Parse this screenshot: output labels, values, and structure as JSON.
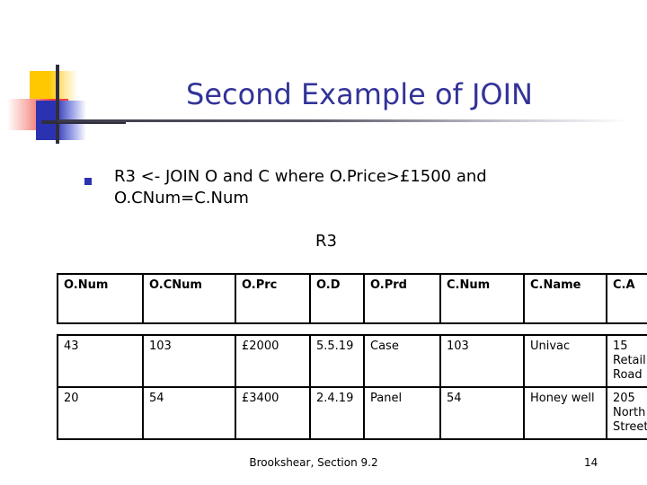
{
  "slide": {
    "title": "Second Example of JOIN",
    "title_color": "#333399",
    "logo": {
      "yellow": "#FFC800",
      "red": "#F2413C",
      "blue": "#2B32B2",
      "line": "#2F2F3F"
    },
    "bullet": {
      "marker": "square-bullet",
      "marker_color": "#2B32B2",
      "text": "R3 <- JOIN O and C where O.Price>£1500 and O.CNum=C.Num"
    },
    "relation_label": "R3",
    "table": {
      "headers": [
        "O.Num",
        "O.CNum",
        "O.Prc",
        "O.D",
        "O.Prd",
        "C.Num",
        "C.Name",
        "C.A"
      ],
      "rows": [
        [
          "43",
          "103",
          "£2000",
          "5.5.19",
          "Case",
          "103",
          "Univac",
          "15 Retail Road"
        ],
        [
          "20",
          "54",
          "£3400",
          "2.4.19",
          "Panel",
          "54",
          "Honey well",
          "205 North Street"
        ]
      ]
    },
    "footer": {
      "note": "Brookshear, Section 9.2",
      "page_number": "14"
    }
  }
}
